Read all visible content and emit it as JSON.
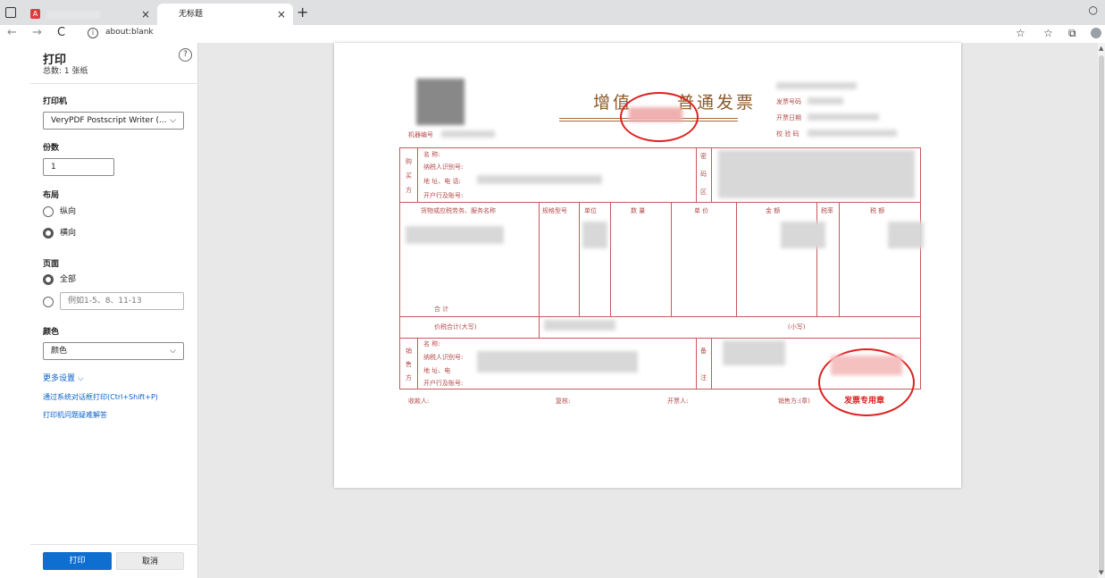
{
  "browser": {
    "tab2_title": "无标题",
    "tab_close": "×",
    "new_tab": "+",
    "url": "about:blank",
    "back": "←",
    "forward": "→",
    "reload": "C"
  },
  "print_panel": {
    "title": "打印",
    "subtitle": "总数: 1 张纸",
    "help": "?",
    "printer_label": "打印机",
    "printer_value": "VeryPDF Postscript Writer (...",
    "copies_label": "份数",
    "copies_value": "1",
    "layout_label": "布局",
    "layout_options": [
      "纵向",
      "横向"
    ],
    "layout_selected": "横向",
    "pages_label": "页面",
    "pages_all": "全部",
    "pages_placeholder": "例如1-5、8、11-13",
    "color_label": "颜色",
    "color_value": "颜色",
    "more_settings": "更多设置 ⌵",
    "system_dialog": "通过系统对话框打印(Ctrl+Shift+P)",
    "troubleshoot": "打印机问题疑难解答",
    "print_button": "打印",
    "cancel_button": "取消"
  },
  "invoice": {
    "title_left": "增值",
    "title_right": "普通发票",
    "invoice_code_label": "发票号码",
    "issue_date_label": "开票日期",
    "check_code_label": "校 验 码",
    "machine_no_label": "机器编号",
    "buyer_side": [
      "购",
      "买",
      "方"
    ],
    "buyer_fields": [
      "名      称:",
      "纳税人识别号:",
      "地 址、电 话:",
      "开户行及账号:"
    ],
    "password_label": [
      "密",
      "码",
      "区"
    ],
    "columns": [
      "货物或应税劳务、服务名称",
      "规格型号",
      "单位",
      "数 量",
      "单 价",
      "金 额",
      "税率",
      "税 额"
    ],
    "total_label": "合          计",
    "total_incl_tax_label": "价税合计(大写)",
    "small_label": "(小写)",
    "seller_side": [
      "销",
      "售",
      "方"
    ],
    "seller_fields": [
      "名      称:",
      "纳税人识别号:",
      "地 址、电",
      "开户行及账号:"
    ],
    "remarks_label": [
      "备",
      "注"
    ],
    "footer": [
      "收款人:",
      "复核:",
      "开票人:",
      "销售方:(章)"
    ],
    "stamp_text": "发票专用章"
  },
  "colors": {
    "accent": "#0f6fd1",
    "invoice_line": "#c65a5a",
    "stamp": "#e02020",
    "title": "#8b5a2b"
  }
}
